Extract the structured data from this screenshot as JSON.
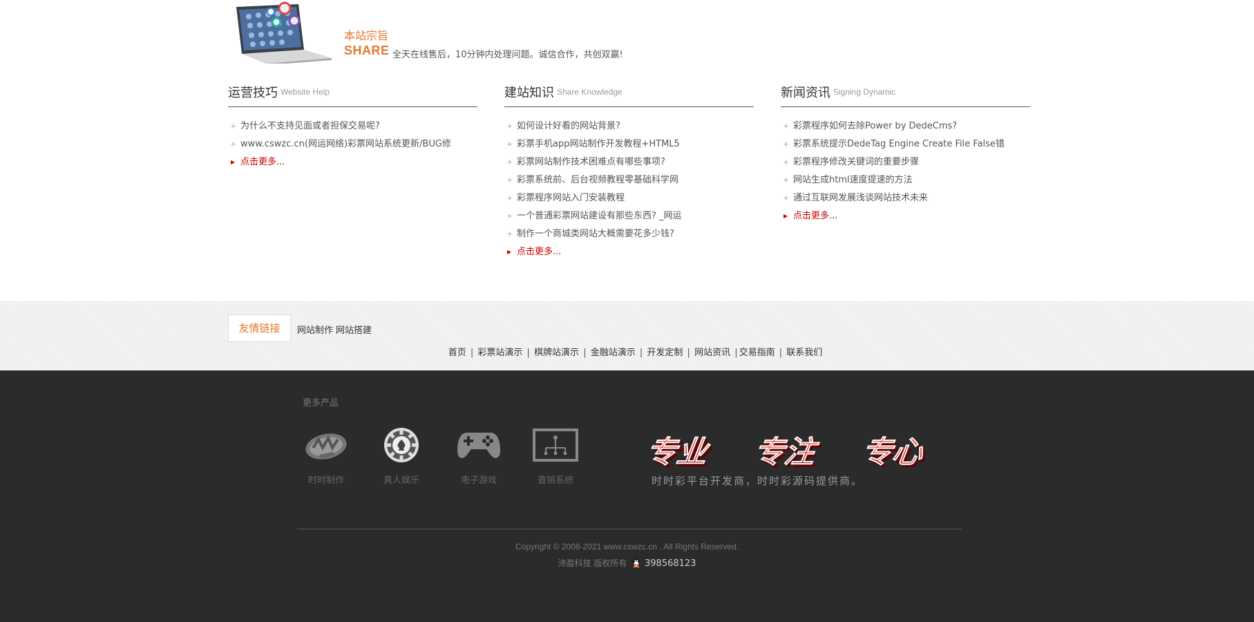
{
  "intro": {
    "title": "本站宗旨",
    "share": "SHARE",
    "description": "全天在线售后，10分钟内处理问题。诚信合作，共创双赢!"
  },
  "columns": [
    {
      "title": "运营技巧",
      "subtitle": "Website Help",
      "items": [
        "为什么不支持见面或者担保交易呢?",
        "www.cswzc.cn(网运网络)彩票网站系统更新/BUG修"
      ],
      "more": "点击更多..."
    },
    {
      "title": "建站知识",
      "subtitle": "Share Knowledge",
      "items": [
        "如何设计好看的网站背景?",
        "彩票手机app网站制作开发教程+HTML5",
        "彩票网站制作技术困难点有哪些事项?",
        "彩票系统前、后台视频教程零基础科学网",
        "彩票程序网站入门安装教程",
        "一个普通彩票网站建设有那些东西? _网运",
        "制作一个商城类网站大概需要花多少钱?"
      ],
      "more": "点击更多..."
    },
    {
      "title": "新闻资讯",
      "subtitle": "Signing Dynamic",
      "items": [
        "彩票程序如何去除Power by DedeCms?",
        "彩票系统提示DedeTag Engine Create File False错",
        "彩票程序修改关键词的重要步骤",
        "网站生成html速度提速的方法",
        "通过互联网发展浅谈网站技术未来"
      ],
      "more": "点击更多..."
    }
  ],
  "friend_links": {
    "label": "友情链接",
    "links": [
      "网站制作",
      "网站搭建"
    ]
  },
  "footer_nav": [
    "首页",
    "彩票站演示",
    "棋牌站演示",
    "金融站演示",
    "开发定制",
    "网站资讯",
    "交易指南",
    "联系我们"
  ],
  "footer_nav_separators": [
    " | ",
    " | ",
    " | ",
    " | ",
    " | ",
    " |",
    " | "
  ],
  "products": {
    "title": "更多产品",
    "items": [
      {
        "label": "时时制作",
        "icon": "lottery-logo-icon"
      },
      {
        "label": "真人娱乐",
        "icon": "casino-chip-icon"
      },
      {
        "label": "电子游戏",
        "icon": "gamepad-icon"
      },
      {
        "label": "直销系统",
        "icon": "network-tree-icon"
      }
    ]
  },
  "slogan": {
    "words": [
      "专业",
      "专注",
      "专心"
    ],
    "text": "时时彩平台开发商，时时彩源码提供商。"
  },
  "copyright": "Copyright © 2008-2021 www.cswzc.cn . All Rights Reserved.",
  "owner": "沛盈科技 版权所有",
  "qq": "398568123",
  "colors": {
    "accent": "#e4782f",
    "more_link": "#cc0000",
    "footer_bg": "#2b2b2b",
    "slogan_red": "#d41414"
  }
}
